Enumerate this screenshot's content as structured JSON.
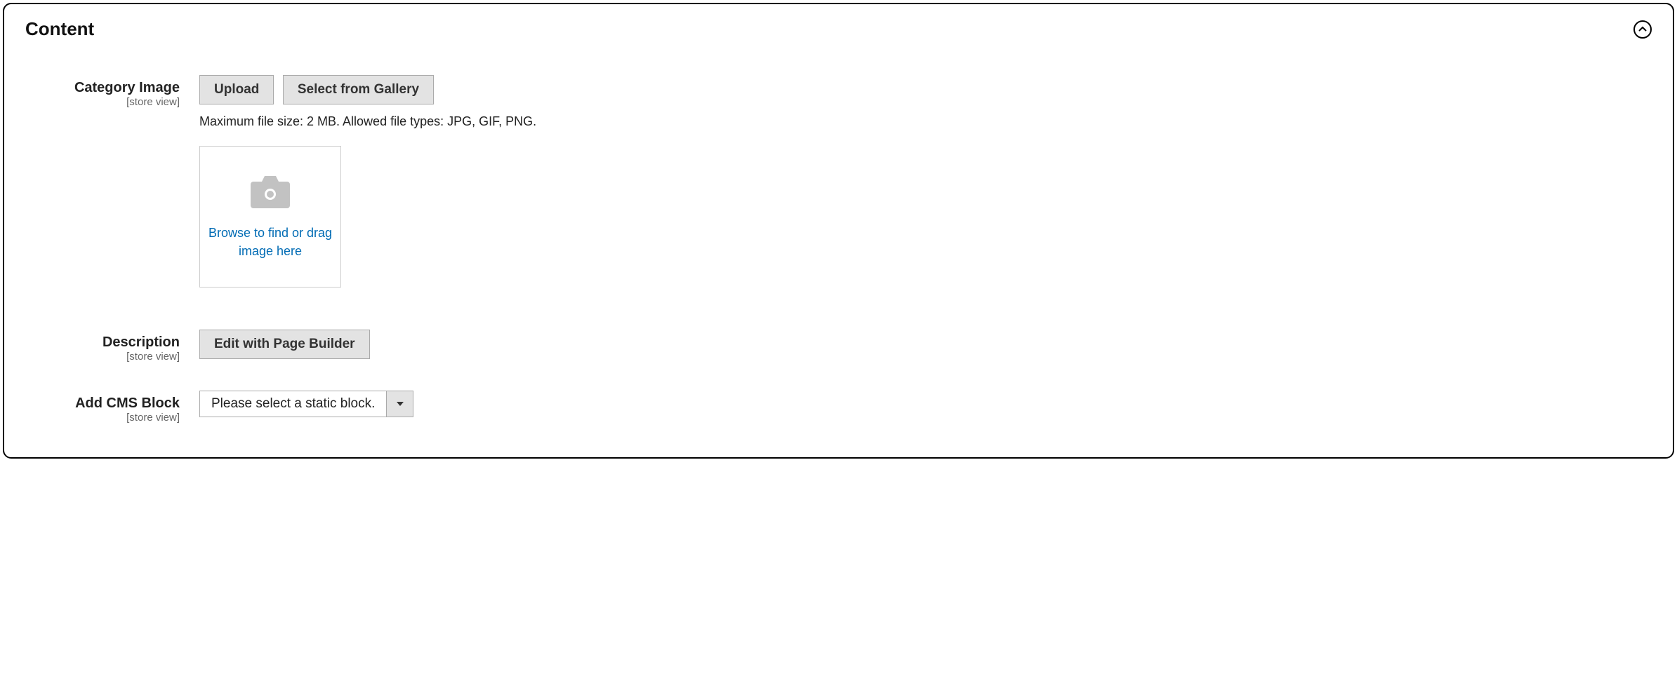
{
  "panel": {
    "title": "Content"
  },
  "categoryImage": {
    "label": "Category Image",
    "scope": "[store view]",
    "upload_label": "Upload",
    "gallery_label": "Select from Gallery",
    "hint": "Maximum file size: 2 MB. Allowed file types: JPG, GIF, PNG.",
    "dropzone_text": "Browse to find or drag image here"
  },
  "description": {
    "label": "Description",
    "scope": "[store view]",
    "edit_label": "Edit with Page Builder"
  },
  "cmsBlock": {
    "label": "Add CMS Block",
    "scope": "[store view]",
    "selected": "Please select a static block."
  }
}
